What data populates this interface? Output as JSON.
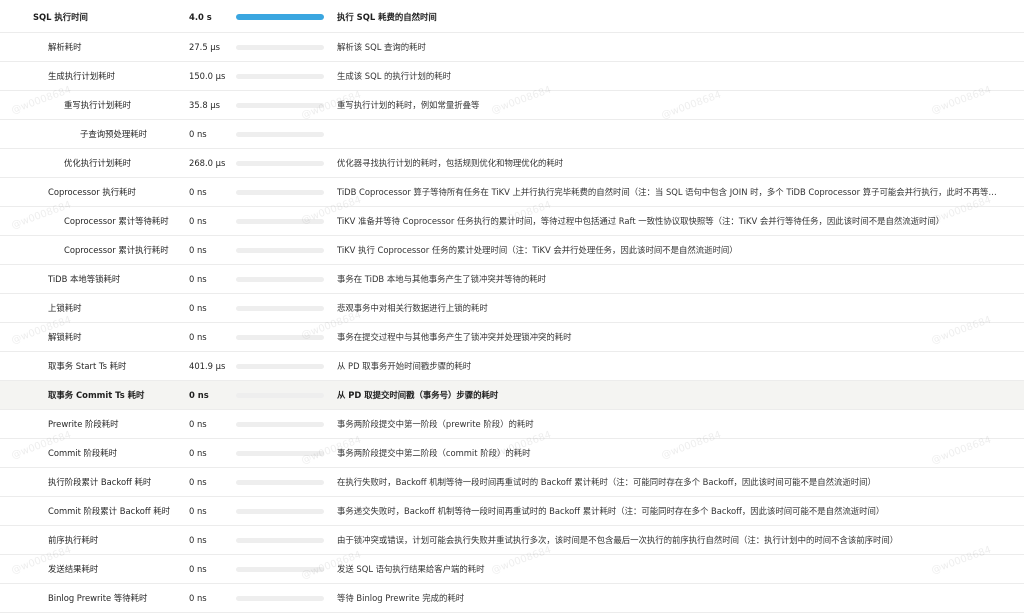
{
  "rows": [
    {
      "name": "SQL 执行时间",
      "value": "4.0 s",
      "desc": "执行 SQL 耗费的自然时间",
      "level": 0,
      "bold": true,
      "fill": 1
    },
    {
      "name": "解析耗时",
      "value": "27.5 µs",
      "desc": "解析该 SQL 查询的耗时",
      "level": 1,
      "fill": 0
    },
    {
      "name": "生成执行计划耗时",
      "value": "150.0 µs",
      "desc": "生成该 SQL 的执行计划的耗时",
      "level": 1,
      "fill": 0
    },
    {
      "name": "重写执行计划耗时",
      "value": "35.8 µs",
      "desc": "重写执行计划的耗时，例如常量折叠等",
      "level": 2,
      "fill": 0
    },
    {
      "name": "子查询预处理耗时",
      "value": "0 ns",
      "desc": "",
      "level": 3,
      "fill": 0
    },
    {
      "name": "优化执行计划耗时",
      "value": "268.0 µs",
      "desc": "优化器寻找执行计划的耗时，包括规则优化和物理优化的耗时",
      "level": 2,
      "fill": 0
    },
    {
      "name": "Coprocessor 执行耗时",
      "value": "0 ns",
      "desc": "TiDB Coprocessor 算子等待所有任务在 TiKV 上并行执行完毕耗费的自然时间（注：当 SQL 语句中包含 JOIN 时，多个 TiDB Coprocessor 算子可能会并行执行，此时不再等价于自然时间）",
      "level": 1,
      "fill": 0
    },
    {
      "name": "Coprocessor 累计等待耗时",
      "value": "0 ns",
      "desc": "TiKV 准备并等待 Coprocessor 任务执行的累计时间，等待过程中包括通过 Raft 一致性协议取快照等（注：TiKV 会并行等待任务，因此该时间不是自然流逝时间）",
      "level": 2,
      "fill": 0
    },
    {
      "name": "Coprocessor 累计执行耗时",
      "value": "0 ns",
      "desc": "TiKV 执行 Coprocessor 任务的累计处理时间（注：TiKV 会并行处理任务，因此该时间不是自然流逝时间）",
      "level": 2,
      "fill": 0
    },
    {
      "name": "TiDB 本地等锁耗时",
      "value": "0 ns",
      "desc": "事务在 TiDB 本地与其他事务产生了锁冲突并等待的耗时",
      "level": 1,
      "fill": 0
    },
    {
      "name": "上锁耗时",
      "value": "0 ns",
      "desc": "悲观事务中对相关行数据进行上锁的耗时",
      "level": 1,
      "fill": 0
    },
    {
      "name": "解锁耗时",
      "value": "0 ns",
      "desc": "事务在提交过程中与其他事务产生了锁冲突并处理锁冲突的耗时",
      "level": 1,
      "fill": 0
    },
    {
      "name": "取事务 Start Ts 耗时",
      "value": "401.9 µs",
      "desc": "从 PD 取事务开始时间戳步骤的耗时",
      "level": 1,
      "fill": 0
    },
    {
      "name": "取事务 Commit Ts 耗时",
      "value": "0 ns",
      "desc": "从 PD 取提交时间戳（事务号）步骤的耗时",
      "level": 1,
      "bold": true,
      "highlight": true,
      "fill": 0
    },
    {
      "name": "Prewrite 阶段耗时",
      "value": "0 ns",
      "desc": "事务两阶段提交中第一阶段（prewrite 阶段）的耗时",
      "level": 1,
      "fill": 0
    },
    {
      "name": "Commit 阶段耗时",
      "value": "0 ns",
      "desc": "事务两阶段提交中第二阶段（commit 阶段）的耗时",
      "level": 1,
      "fill": 0
    },
    {
      "name": "执行阶段累计 Backoff 耗时",
      "value": "0 ns",
      "desc": "在执行失败时，Backoff 机制等待一段时间再重试时的 Backoff 累计耗时（注：可能同时存在多个 Backoff，因此该时间可能不是自然流逝时间）",
      "level": 1,
      "fill": 0
    },
    {
      "name": "Commit 阶段累计 Backoff 耗时",
      "value": "0 ns",
      "desc": "事务递交失败时，Backoff 机制等待一段时间再重试时的 Backoff 累计耗时（注：可能同时存在多个 Backoff，因此该时间可能不是自然流逝时间）",
      "level": 1,
      "fill": 0
    },
    {
      "name": "前序执行耗时",
      "value": "0 ns",
      "desc": "由于锁冲突或错误，计划可能会执行失败并重试执行多次，该时间是不包含最后一次执行的前序执行自然时间（注：执行计划中的时间不含该前序时间）",
      "level": 1,
      "fill": 0
    },
    {
      "name": "发送结果耗时",
      "value": "0 ns",
      "desc": "发送 SQL 语句执行结果给客户端的耗时",
      "level": 1,
      "fill": 0
    },
    {
      "name": "Binlog Prewrite 等待耗时",
      "value": "0 ns",
      "desc": "等待 Binlog Prewrite 完成的耗时",
      "level": 1,
      "fill": 0
    }
  ],
  "colors": {
    "bar_fill": "#3aa6e0",
    "bar_track": "#eeeeee",
    "highlight_row": "#f4f4f2"
  },
  "watermark": "@w0008684"
}
